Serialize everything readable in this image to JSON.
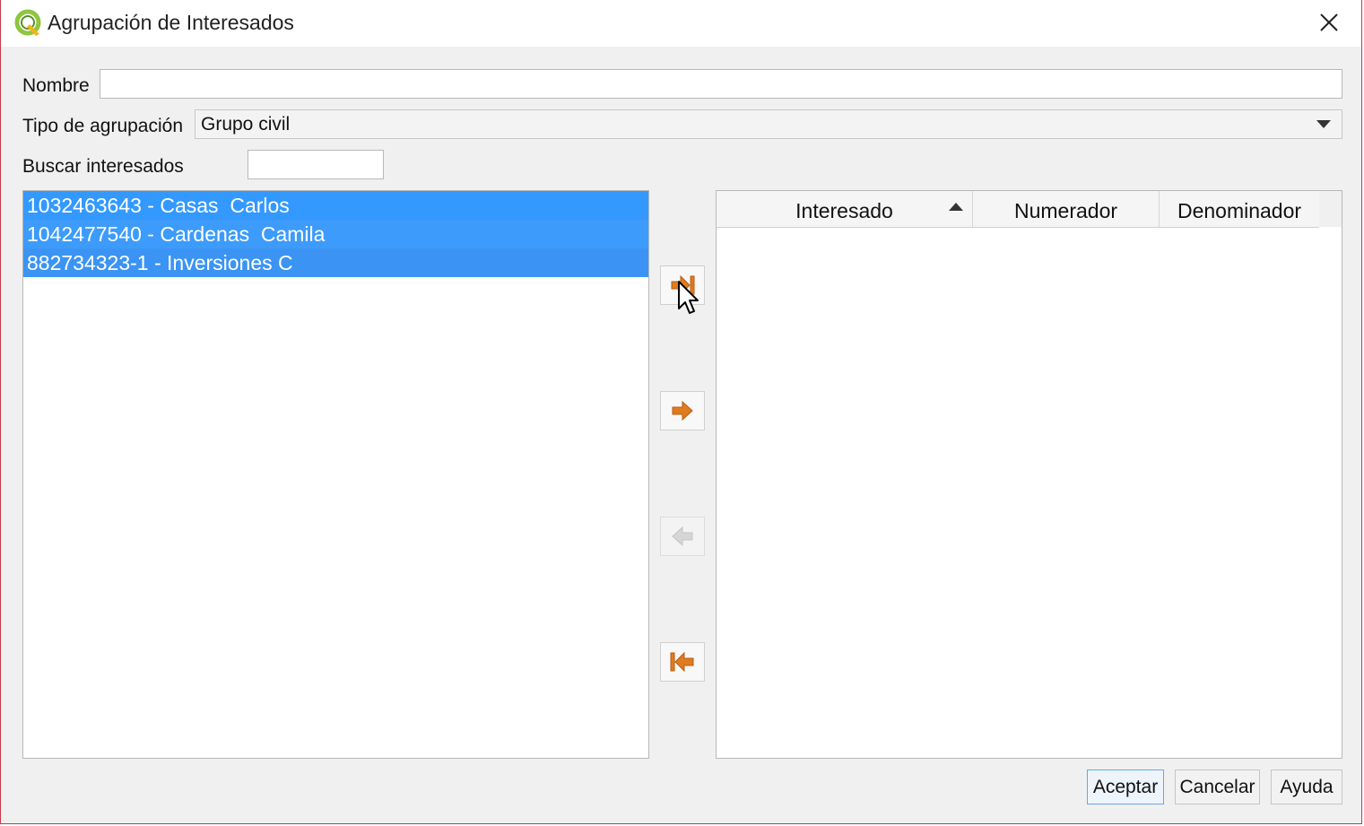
{
  "window": {
    "title": "Agrupación de Interesados"
  },
  "form": {
    "name_label": "Nombre",
    "name_value": "",
    "type_label": "Tipo de agrupación",
    "type_value": "Grupo civil",
    "search_label": "Buscar interesados",
    "search_value": ""
  },
  "available_list": {
    "items": [
      {
        "label": "1032463643 - Casas  Carlos",
        "selected": true
      },
      {
        "label": "1042477540 - Cardenas  Camila",
        "selected": true
      },
      {
        "label": "882734323-1 - Inversiones C",
        "selected": true
      }
    ]
  },
  "selected_table": {
    "columns": [
      "Interesado",
      "Numerador",
      "Denominador"
    ],
    "sort_column": "Interesado",
    "sort_order": "ascending",
    "rows": []
  },
  "transfer_buttons": [
    {
      "icon": "move-all-right-icon",
      "enabled": true
    },
    {
      "icon": "move-right-icon",
      "enabled": true
    },
    {
      "icon": "move-left-icon",
      "enabled": false
    },
    {
      "icon": "move-all-left-icon",
      "enabled": true
    }
  ],
  "buttons": {
    "accept": "Aceptar",
    "cancel": "Cancelar",
    "help": "Ayuda"
  },
  "colors": {
    "selection": "#3399ff",
    "arrow_orange": "#e07b1f",
    "window_border": "#c53a4a"
  }
}
